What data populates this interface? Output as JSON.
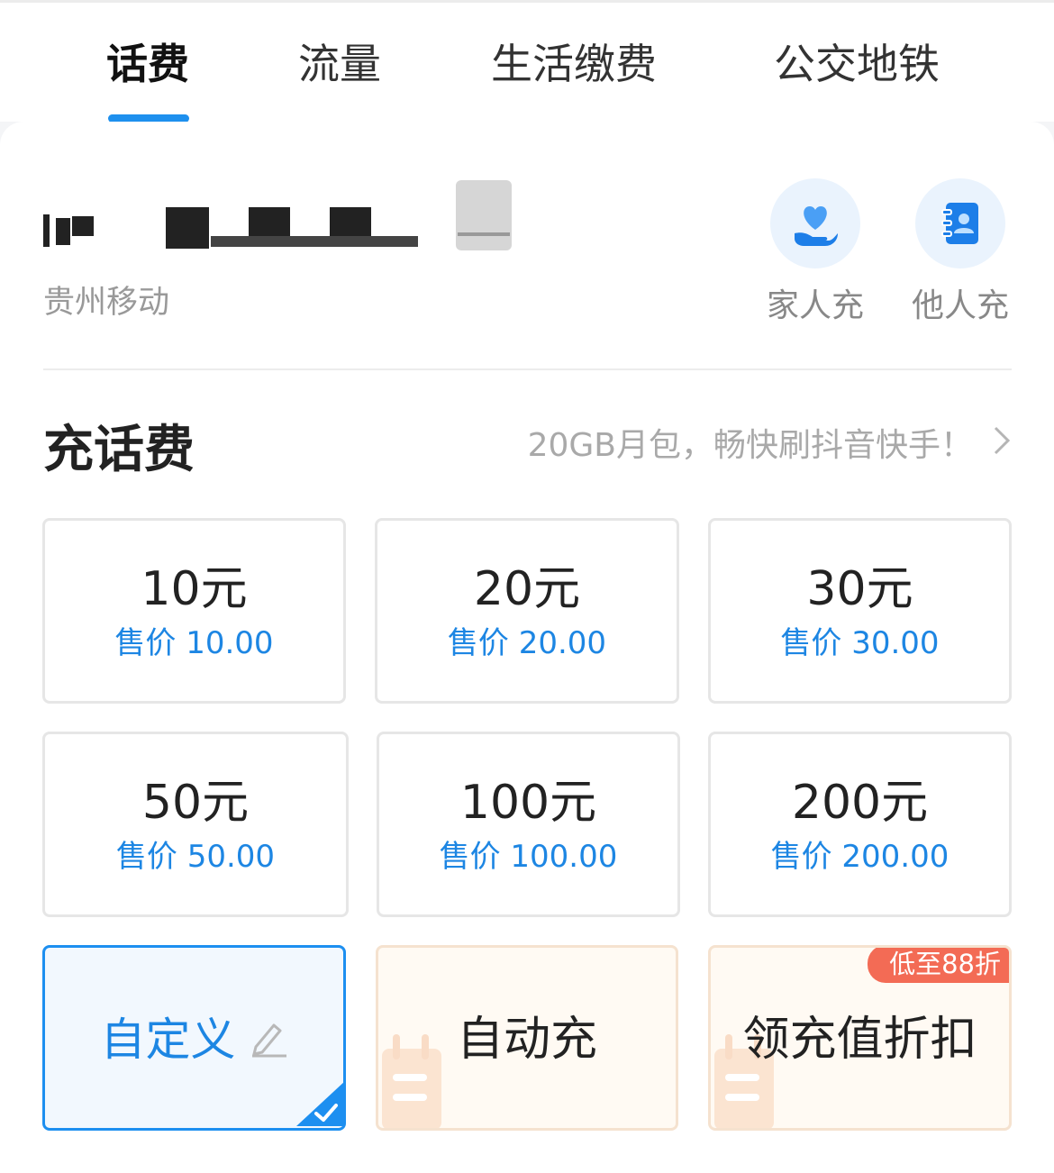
{
  "tabs": [
    {
      "label": "话费",
      "active": true
    },
    {
      "label": "流量",
      "active": false
    },
    {
      "label": "生活缴费",
      "active": false
    },
    {
      "label": "公交地铁",
      "active": false
    }
  ],
  "account": {
    "carrier": "贵州移动"
  },
  "quick_actions": [
    {
      "label": "家人充",
      "icon": "heart-hand-icon"
    },
    {
      "label": "他人充",
      "icon": "contacts-book-icon"
    }
  ],
  "section": {
    "title": "充话费",
    "promo": "20GB月包，畅快刷抖音快手！"
  },
  "packages": [
    {
      "amount": "10元",
      "price": "售价 10.00"
    },
    {
      "amount": "20元",
      "price": "售价 20.00"
    },
    {
      "amount": "30元",
      "price": "售价 30.00"
    },
    {
      "amount": "50元",
      "price": "售价 50.00"
    },
    {
      "amount": "100元",
      "price": "售价 100.00"
    },
    {
      "amount": "200元",
      "price": "售价 200.00"
    }
  ],
  "options": {
    "custom": {
      "label": "自定义",
      "selected": true
    },
    "auto": {
      "label": "自动充"
    },
    "discount": {
      "label": "领充值折扣",
      "badge": "低至88折"
    }
  },
  "colors": {
    "accent": "#1d86e3",
    "badge": "#f36b55",
    "warm_tile": "#fffaf3"
  }
}
